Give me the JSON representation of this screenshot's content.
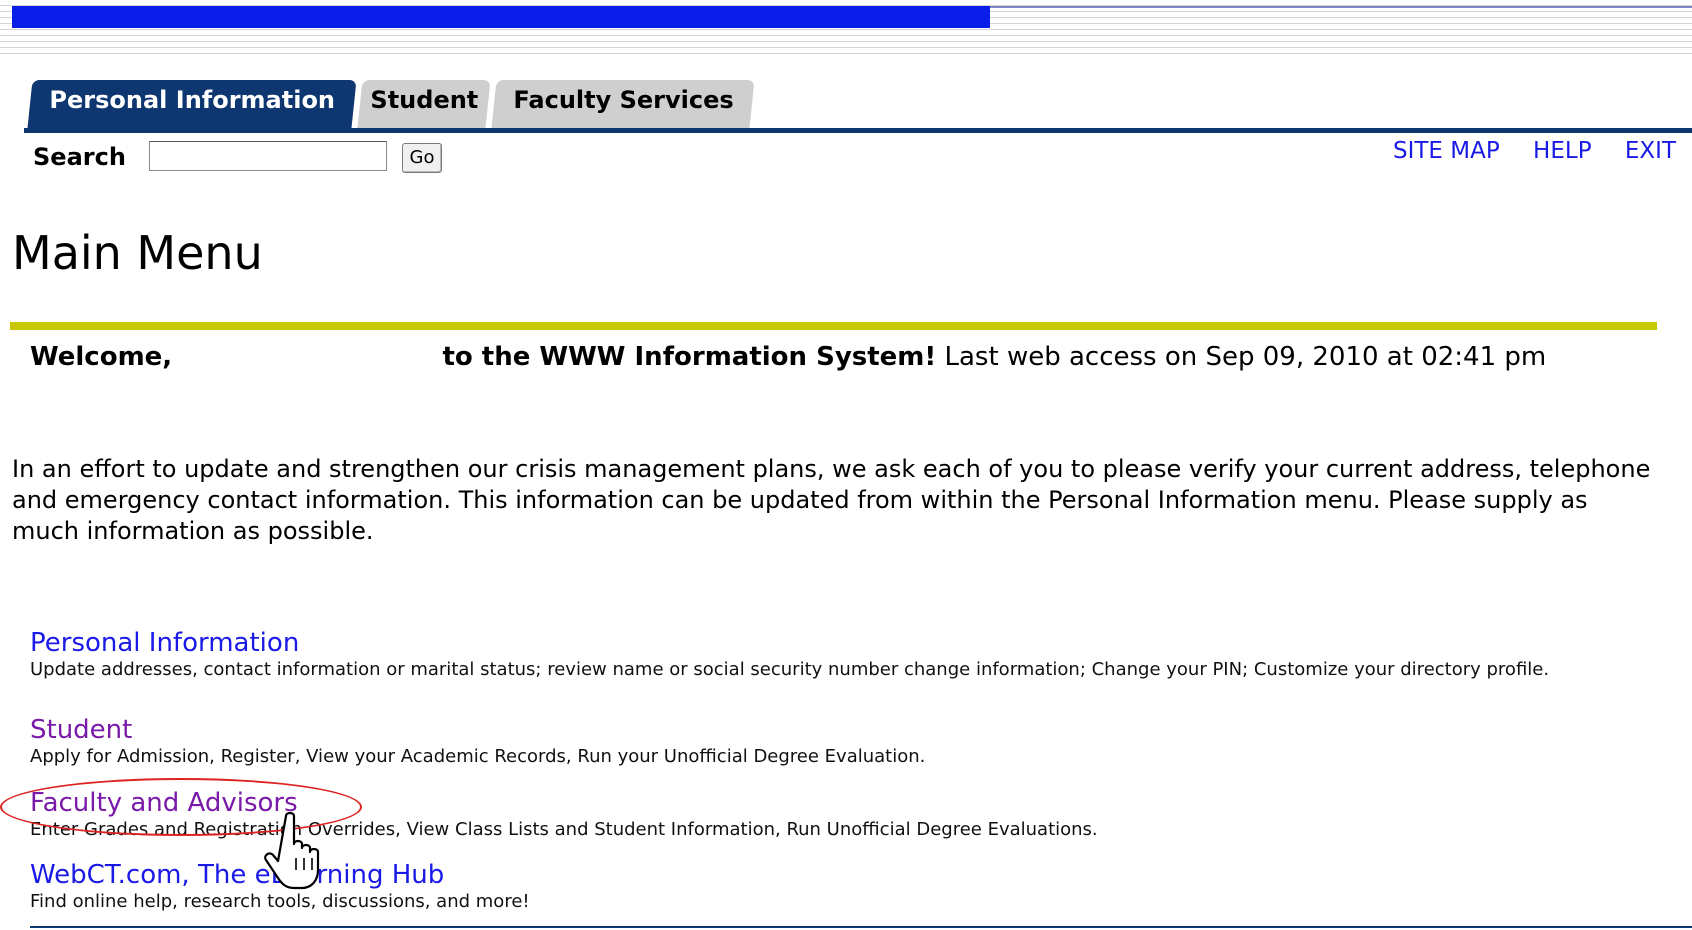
{
  "tabs": [
    {
      "label": "Personal Information",
      "active": true
    },
    {
      "label": "Student",
      "active": false
    },
    {
      "label": "Faculty Services",
      "active": false
    }
  ],
  "search": {
    "label": "Search",
    "value": "",
    "placeholder": "",
    "go_label": "Go"
  },
  "utility_links": {
    "site_map": "SITE MAP",
    "help": "HELP",
    "exit": "EXIT"
  },
  "page_title": "Main Menu",
  "welcome": {
    "greeting": "Welcome,",
    "system_text": "to the WWW Information System!",
    "last_access": "Last web access on Sep 09, 2010 at 02:41 pm"
  },
  "notice": "In an effort to update and strengthen our crisis management plans, we ask each of you to please verify your current address, telephone and emergency contact information. This information can be updated from within the Personal Information menu. Please supply as much information as possible.",
  "menu_items": [
    {
      "title": "Personal Information",
      "description": "Update addresses, contact information or marital status; review name or social security number change information; Change your PIN; Customize your directory profile."
    },
    {
      "title": "Student",
      "description": "Apply for Admission, Register, View your Academic Records, Run your Unofficial Degree Evaluation."
    },
    {
      "title": "Faculty and Advisors",
      "description": "Enter Grades and Registration Overrides, View Class Lists and Student Information, Run Unofficial Degree Evaluations."
    },
    {
      "title": "WebCT.com, The eLearning Hub",
      "description": "Find online help, research tools, discussions, and more!"
    }
  ],
  "colors": {
    "nav_blue": "#0e3670",
    "banner_blue": "#0b1de8",
    "rule_yellow": "#c8c800",
    "link_blue": "#1a1ae6",
    "link_visited": "#7a1aa8",
    "annotation_red": "#d22222"
  },
  "icons": {
    "cursor": "hand-pointer-icon"
  }
}
